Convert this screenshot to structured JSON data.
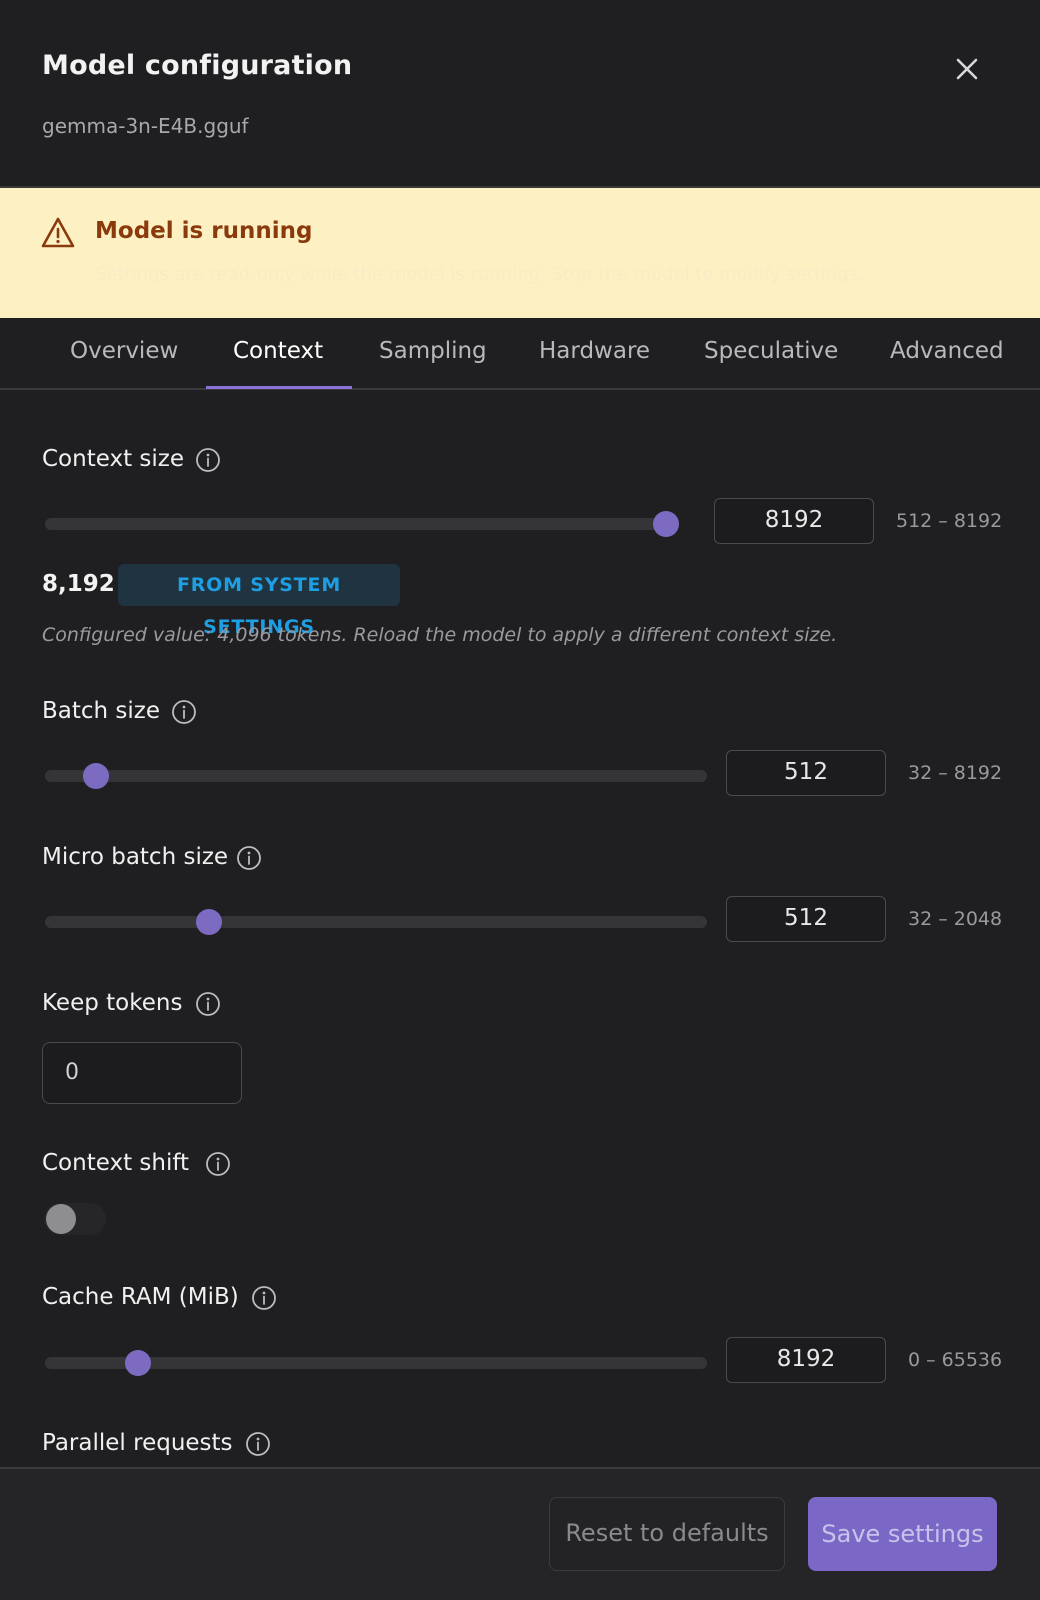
{
  "header": {
    "title": "Model configuration",
    "subtitle": "gemma-3n-E4B.gguf",
    "close_icon": "close-icon"
  },
  "banner": {
    "icon": "warning-triangle-icon",
    "title": "Model is running",
    "text": "Settings are read-only while the model is running. Stop the model to modify settings."
  },
  "tabs": [
    {
      "label": "Overview",
      "active": false
    },
    {
      "label": "Context",
      "active": true
    },
    {
      "label": "Sampling",
      "active": false
    },
    {
      "label": "Hardware",
      "active": false
    },
    {
      "label": "Speculative",
      "active": false
    },
    {
      "label": "Advanced",
      "active": false
    }
  ],
  "fields": {
    "context_size": {
      "label": "Context size",
      "value": "8192",
      "range": "512 – 8192",
      "slider_fraction": 1.0,
      "display_value": "8,192",
      "badge": "FROM SYSTEM SETTINGS",
      "note": "Configured value: 4,096 tokens. Reload the model to apply a different context size."
    },
    "batch_size": {
      "label": "Batch size",
      "value": "512",
      "range": "32 – 8192",
      "slider_fraction": 0.059
    },
    "micro_batch_size": {
      "label": "Micro batch size",
      "value": "512",
      "range": "32 – 2048",
      "slider_fraction": 0.238
    },
    "keep_tokens": {
      "label": "Keep tokens",
      "value": "0"
    },
    "context_shift": {
      "label": "Context shift",
      "enabled": false
    },
    "cache_ram": {
      "label": "Cache RAM (MiB)",
      "value": "8192",
      "range": "0 – 65536",
      "slider_fraction": 0.125
    },
    "parallel_requests": {
      "label": "Parallel requests"
    }
  },
  "footer": {
    "reset_label": "Reset to defaults",
    "save_label": "Save settings"
  },
  "colors": {
    "accent": "#7b68c6",
    "banner_bg": "#fdf1c4",
    "banner_title": "#8a3a0d",
    "badge_text": "#1e9ee3"
  }
}
